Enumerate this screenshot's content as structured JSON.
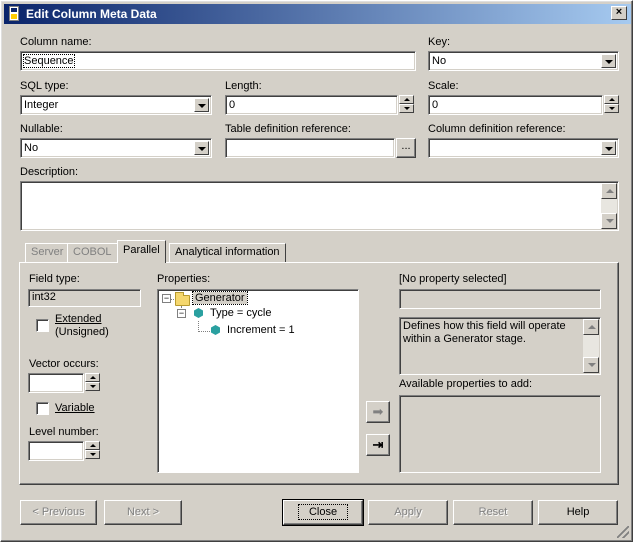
{
  "window": {
    "title": "Edit Column Meta Data",
    "close_glyph": "×"
  },
  "column_name": {
    "label": "Column name:",
    "value": "Sequence"
  },
  "key": {
    "label": "Key:",
    "value": "No"
  },
  "sql_type": {
    "label": "SQL type:",
    "value": "Integer"
  },
  "length": {
    "label": "Length:",
    "value": "0"
  },
  "scale": {
    "label": "Scale:",
    "value": "0"
  },
  "nullable": {
    "label": "Nullable:",
    "value": "No"
  },
  "table_def_ref": {
    "label": "Table definition reference:",
    "value": "",
    "browse_label": "..."
  },
  "column_def_ref": {
    "label": "Column definition reference:",
    "value": ""
  },
  "description": {
    "label": "Description:",
    "value": ""
  },
  "tabs": [
    {
      "label": "Server",
      "state": "disabled"
    },
    {
      "label": "COBOL",
      "state": "disabled"
    },
    {
      "label": "Parallel",
      "state": "active"
    },
    {
      "label": "Analytical information",
      "state": "normal"
    }
  ],
  "parallel": {
    "field_type_label": "Field type:",
    "field_type_value": "int32",
    "extended_label_1": "Extended",
    "extended_label_2": "(Unsigned)",
    "extended_checked": false,
    "vector_occurs_label": "Vector occurs:",
    "vector_occurs_value": "",
    "variable_label": "Variable",
    "variable_checked": false,
    "level_number_label": "Level number:",
    "level_number_value": "",
    "properties_label": "Properties:",
    "tree": [
      {
        "label": "Generator",
        "icon": "folder-icon",
        "depth": 0,
        "expander": "minus"
      },
      {
        "label": "Type = cycle",
        "icon": "property-icon",
        "depth": 1,
        "expander": "minus"
      },
      {
        "label": "Increment = 1",
        "icon": "property-icon",
        "depth": 2,
        "expander": ""
      }
    ],
    "no_property_label": "[No property selected]",
    "property_value": "",
    "help_text": "Defines how this field will operate within a Generator stage.",
    "available_label": "Available properties to add:",
    "add_arrow_glyph": "➡",
    "add_end_glyph": "⇥"
  },
  "buttons": {
    "previous": "< Previous",
    "next": "Next >",
    "close": "Close",
    "apply": "Apply",
    "reset": "Reset",
    "help": "Help"
  }
}
